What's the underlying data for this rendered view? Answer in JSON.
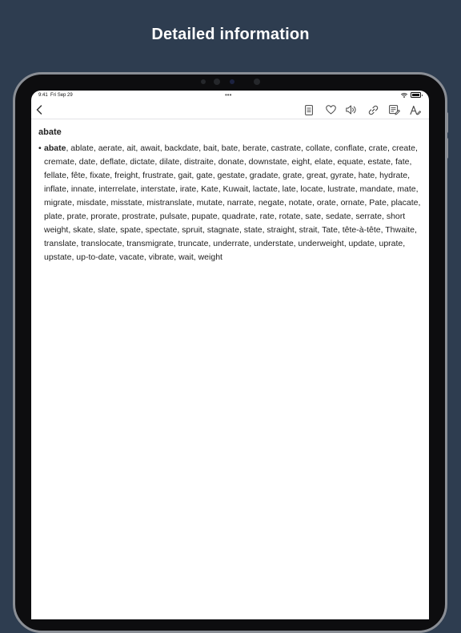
{
  "page": {
    "headline": "Detailed information"
  },
  "status_bar": {
    "time": "9:41",
    "date": "Fri Sep 29",
    "multitask_dots": "•••"
  },
  "toolbar": {
    "icons": [
      "chevron-left-icon",
      "document-icon",
      "heart-icon",
      "speaker-icon",
      "link-icon",
      "edit-note-icon",
      "text-size-icon"
    ]
  },
  "entry": {
    "title": "abate",
    "bullet": "•",
    "term": "abate",
    "rhymes": ", ablate, aerate, ait, await, backdate, bait, bate, berate, castrate, collate, conflate, crate, create, cremate, date, deflate, dictate, dilate, distraite, donate, downstate, eight, elate, equate, estate, fate, fellate, fête, fixate, freight, frustrate, gait, gate, gestate, gradate, grate, great, gyrate, hate, hydrate, inflate, innate, interrelate, interstate, irate, Kate, Kuwait, lactate, late, locate, lustrate, mandate, mate, migrate, misdate, misstate, mistranslate, mutate, narrate, negate, notate, orate, ornate, Pate, placate, plate, prate, prorate, prostrate, pulsate, pupate, quadrate, rate, rotate, sate, sedate, serrate, short weight, skate, slate, spate, spectate, spruit, stagnate, state, straight, strait, Tate, tête-à-tête, Thwaite, translate, translocate, transmigrate, truncate, underrate, understate, underweight, update, uprate, upstate, up-to-date, vacate, vibrate, wait, weight"
  },
  "colors": {
    "background": "#2e3d50",
    "screen": "#ffffff",
    "text": "#222222",
    "icon": "#444444"
  }
}
